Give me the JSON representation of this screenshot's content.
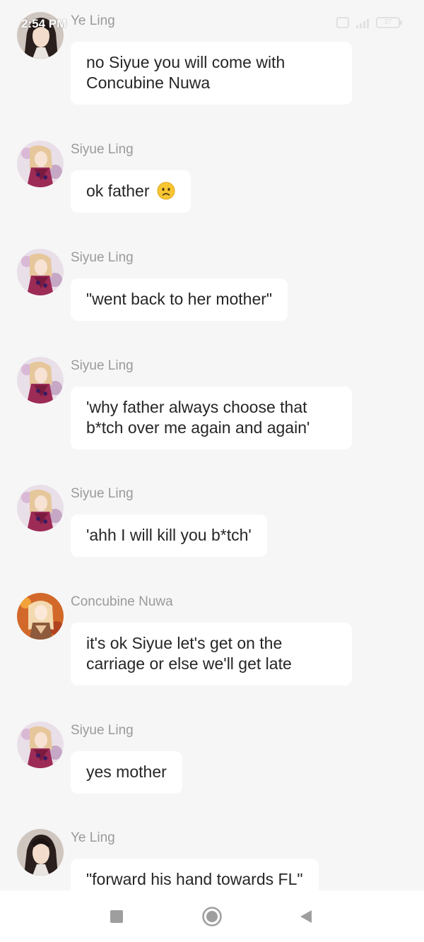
{
  "status_bar": {
    "time": "2:54 PM",
    "battery": "37"
  },
  "messages": [
    {
      "sender": "Ye Ling",
      "avatar": "ye-ling-avatar",
      "text_lines": [
        "no Siyue you will come with",
        "Concubine Nuwa"
      ]
    },
    {
      "sender": "Siyue Ling",
      "avatar": "siyue-ling-avatar",
      "text": "ok father",
      "emoji": "worried-face-emoji"
    },
    {
      "sender": "Siyue Ling",
      "avatar": "siyue-ling-avatar",
      "text": "\"went back to her mother\""
    },
    {
      "sender": "Siyue Ling",
      "avatar": "siyue-ling-avatar",
      "text_lines": [
        "'why father always choose that",
        "b*tch over me again and again'"
      ]
    },
    {
      "sender": "Siyue Ling",
      "avatar": "siyue-ling-avatar",
      "text": "'ahh I will kill you b*tch'"
    },
    {
      "sender": "Concubine Nuwa",
      "avatar": "concubine-nuwa-avatar",
      "text_lines": [
        "it's ok Siyue let's get on the",
        "carriage or else we'll get late"
      ]
    },
    {
      "sender": "Siyue Ling",
      "avatar": "siyue-ling-avatar",
      "text": "yes mother"
    },
    {
      "sender": "Ye Ling",
      "avatar": "ye-ling-avatar",
      "text": "\"forward his hand towards FL\""
    }
  ],
  "nav_bar": {
    "icons": [
      "recents-square-icon",
      "home-circle-icon",
      "back-triangle-icon"
    ]
  },
  "colors": {
    "background": "#f6f6f6",
    "bubble": "#ffffff",
    "sender_name": "#9a9a9a",
    "message_text": "#262626",
    "nav_icon": "#9e9e9e"
  }
}
